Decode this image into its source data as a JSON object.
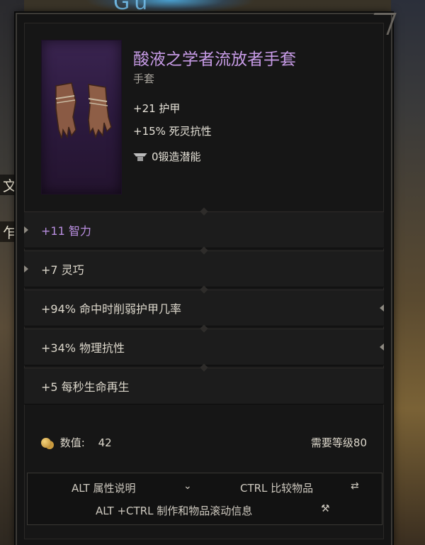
{
  "background": {
    "top_text": "Gu",
    "side_fragments": [
      "文",
      "乍文"
    ]
  },
  "item": {
    "name": "酸液之学者流放者手套",
    "type": "手套",
    "name_color": "#c79be6",
    "base_stats": [
      "+21 护甲",
      "+15% 死灵抗性"
    ],
    "forge_potential": "0锻造潜能",
    "image_icon": "leather-gloves-icon"
  },
  "affixes": [
    {
      "text": "+11 智力",
      "color": "purple"
    },
    {
      "text": "+7 灵巧",
      "color": "normal"
    },
    {
      "text": "+94% 命中时削弱护甲几率",
      "color": "normal"
    },
    {
      "text": "+34% 物理抗性",
      "color": "normal"
    },
    {
      "text": "+5 每秒生命再生",
      "color": "normal"
    }
  ],
  "footer": {
    "value_label": "数值:",
    "value": "42",
    "level_req": "需要等级80"
  },
  "hints": {
    "alt": "ALT 属性说明",
    "ctrl": "CTRL 比较物品",
    "alt_ctrl": "ALT +CTRL 制作和物品滚动信息"
  }
}
